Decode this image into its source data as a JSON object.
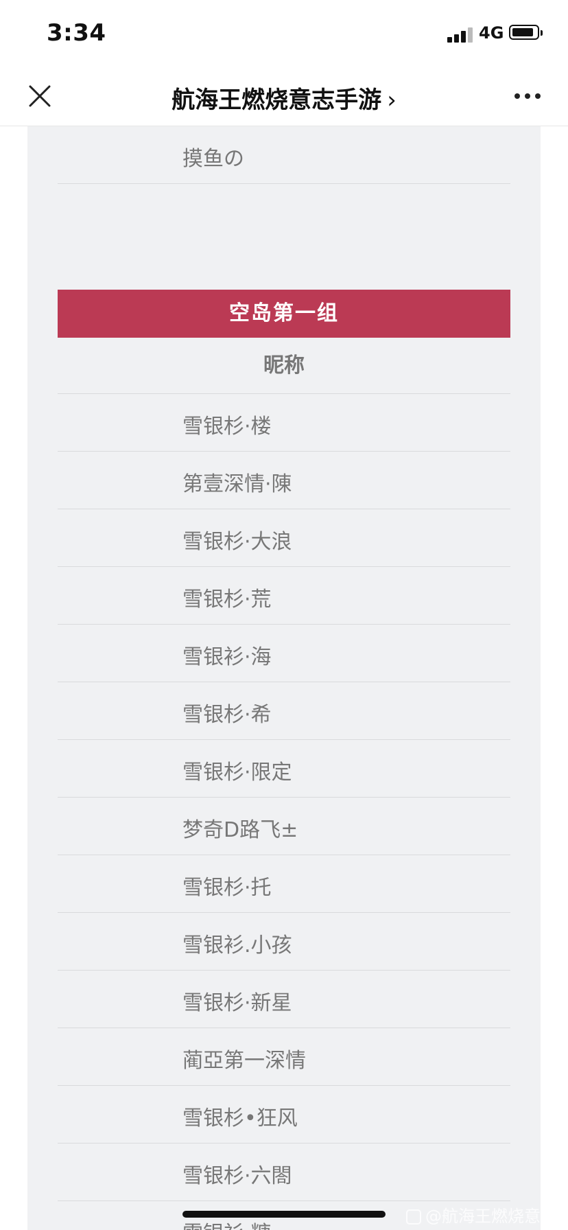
{
  "status_bar": {
    "time": "3:34",
    "network": "4G"
  },
  "nav": {
    "title": "航海王燃烧意志手游",
    "chevron": "›"
  },
  "previous_section": {
    "last_name": "摸鱼の"
  },
  "group": {
    "title": "空岛第一组",
    "column_header": "昵称",
    "members": [
      "雪银杉·楼",
      "第壹深情·陳",
      "雪银杉·大浪",
      "雪银杉·荒",
      "雪银衫·海",
      "雪银杉·希",
      "雪银杉·限定",
      "梦奇D路飞±",
      "雪银杉·托",
      "雪银衫.小孩",
      "雪银杉·新星",
      "蔺亞第一深情",
      "雪银杉•狂风",
      "雪银杉·六閤",
      "雪银衫·糖"
    ]
  },
  "watermark": "@航海王燃烧意志",
  "colors": {
    "header_red": "#bb3a54",
    "card_bg": "#f0f1f3",
    "text_gray": "#777777"
  }
}
